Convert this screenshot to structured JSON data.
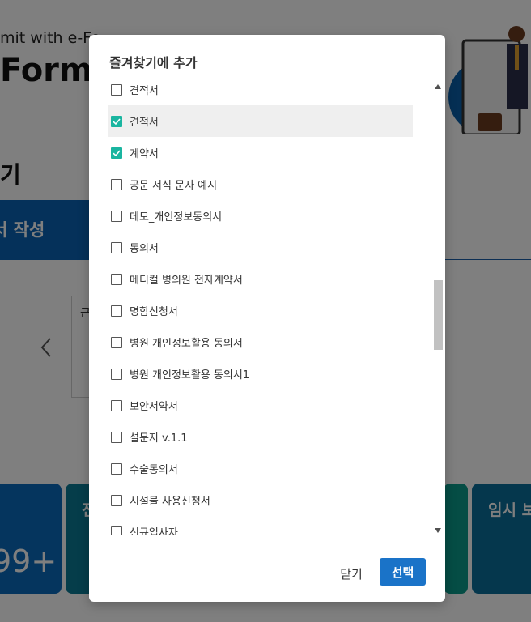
{
  "background": {
    "tagline": "mit with e-Fo",
    "brand": "Form",
    "section_title": "기",
    "write_button": "서 작성",
    "card_label": "근",
    "tile_count": "99+",
    "tile2_label": "전",
    "tile4_label": "임시 보"
  },
  "modal": {
    "title": "즐겨찾기에 추가",
    "items": [
      {
        "label": "견적서",
        "checked": false
      },
      {
        "label": "견적서",
        "checked": true,
        "hover": true
      },
      {
        "label": "계약서",
        "checked": true
      },
      {
        "label": "공문 서식 문자 예시",
        "checked": false
      },
      {
        "label": "데모_개인정보동의서",
        "checked": false
      },
      {
        "label": "동의서",
        "checked": false
      },
      {
        "label": "메디컬 병의원 전자계약서",
        "checked": false
      },
      {
        "label": "명함신청서",
        "checked": false
      },
      {
        "label": "병원 개인정보활용 동의서",
        "checked": false
      },
      {
        "label": "병원 개인정보활용 동의서1",
        "checked": false
      },
      {
        "label": "보안서약서",
        "checked": false
      },
      {
        "label": "설문지 v.1.1",
        "checked": false
      },
      {
        "label": "수술동의서",
        "checked": false
      },
      {
        "label": "시설물 사용신청서",
        "checked": false
      },
      {
        "label": "신규입사자",
        "checked": false
      }
    ],
    "close_label": "닫기",
    "select_label": "선택",
    "accent_color": "#1ab5a0",
    "primary_color": "#1a73c8"
  }
}
